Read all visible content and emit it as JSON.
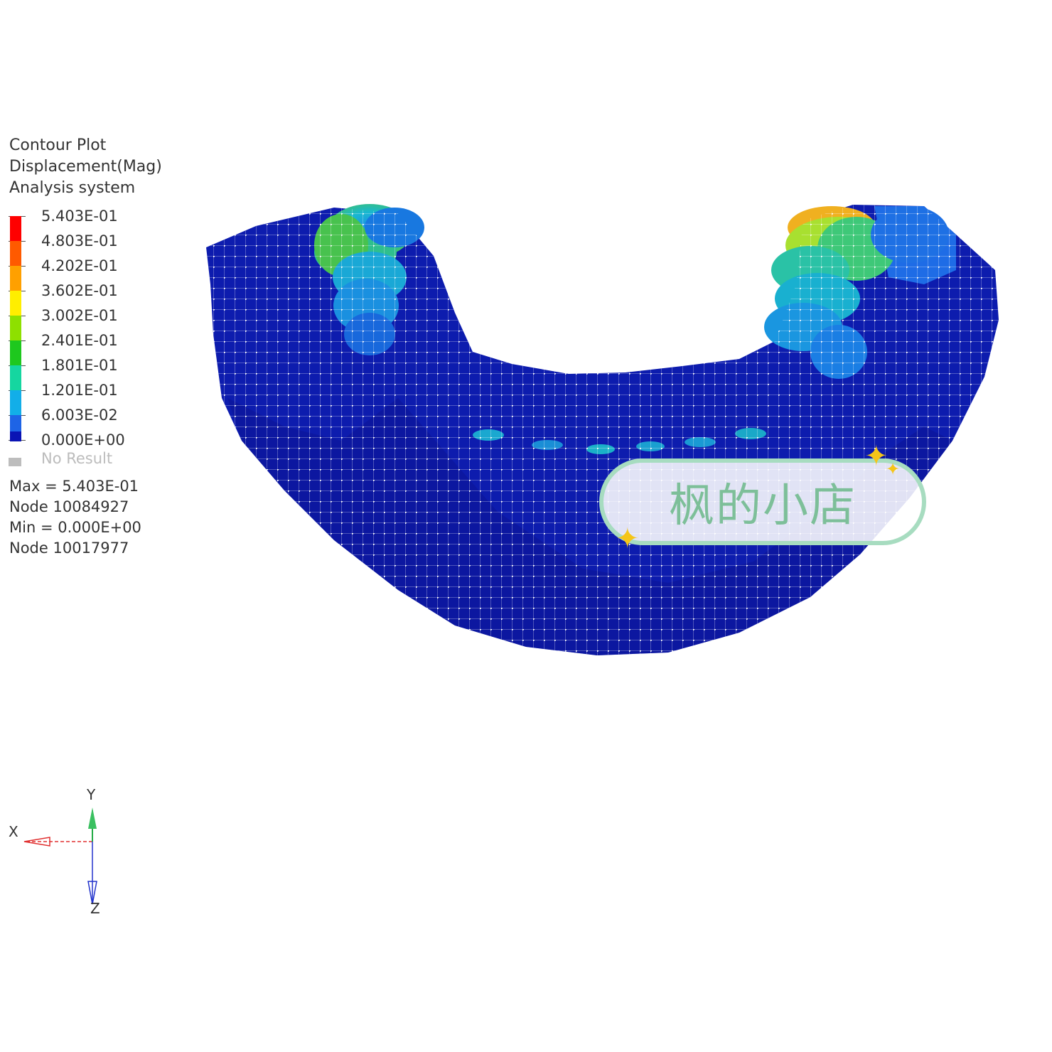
{
  "legend": {
    "title_line1": "Contour Plot",
    "title_line2": "Displacement(Mag)",
    "title_line3": "Analysis system",
    "levels": [
      {
        "value": "5.403E-01",
        "color": "#ff0000"
      },
      {
        "value": "4.803E-01",
        "color": "#ff5a00"
      },
      {
        "value": "4.202E-01",
        "color": "#ffa000"
      },
      {
        "value": "3.602E-01",
        "color": "#ffee00"
      },
      {
        "value": "3.002E-01",
        "color": "#8ee000"
      },
      {
        "value": "2.401E-01",
        "color": "#1ec81e"
      },
      {
        "value": "1.801E-01",
        "color": "#15d6a0"
      },
      {
        "value": "1.201E-01",
        "color": "#12aee8"
      },
      {
        "value": "6.003E-02",
        "color": "#1e64e6"
      },
      {
        "value": "0.000E+00",
        "color": "#0a14b4"
      }
    ],
    "no_result_label": "No Result"
  },
  "extrema": {
    "max_label": "Max = 5.403E-01",
    "max_node": "Node 10084927",
    "min_label": "Min = 0.000E+00",
    "min_node": "Node 10017977"
  },
  "axes": {
    "x_label": "X",
    "y_label": "Y",
    "z_label": "Z",
    "x_color": "#e03030",
    "y_color": "#22aa44",
    "z_color": "#2233cc"
  },
  "watermark": {
    "text": "枫的小店",
    "border_color": "#a7dcc0",
    "text_color": "#7dbf99"
  },
  "model": {
    "base_color": "#0d1cae",
    "mesh_color": "#ffffff"
  }
}
